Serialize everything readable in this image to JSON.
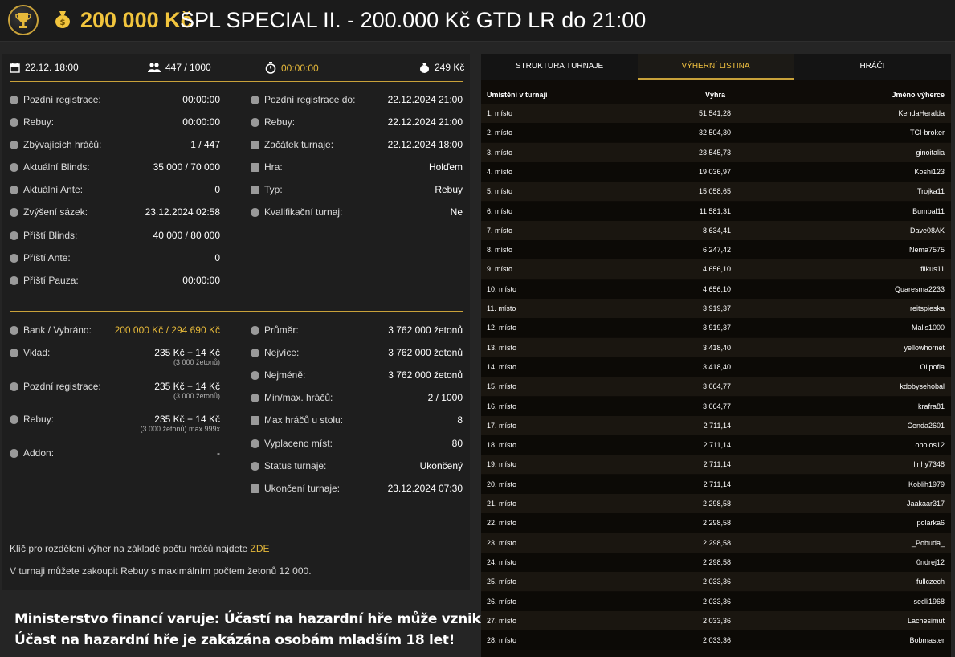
{
  "header": {
    "prize": "200 000 Kč",
    "title": "SPL SPECIAL II. - 200.000 Kč GTD LR do 21:00"
  },
  "topbar": {
    "date": "22.12. 18:00",
    "players": "447 / 1000",
    "timer": "00:00:00",
    "price": "249 Kč"
  },
  "info_left": [
    {
      "label": "Pozdní registrace:",
      "value": "00:00:00"
    },
    {
      "label": "Rebuy:",
      "value": "00:00:00"
    },
    {
      "label": "Zbývajících hráčů:",
      "value": "1 / 447"
    },
    {
      "label": "Aktuální Blinds:",
      "value": "35 000 / 70 000"
    },
    {
      "label": "Aktuální Ante:",
      "value": "0"
    },
    {
      "label": "Zvýšení sázek:",
      "value": "23.12.2024 02:58"
    },
    {
      "label": "Příští Blinds:",
      "value": "40 000 / 80 000"
    },
    {
      "label": "Příští Ante:",
      "value": "0"
    },
    {
      "label": "Příští Pauza:",
      "value": "00:00:00"
    }
  ],
  "info_right": [
    {
      "label": "Pozdní registrace do:",
      "value": "22.12.2024 21:00"
    },
    {
      "label": "Rebuy:",
      "value": "22.12.2024 21:00"
    },
    {
      "label": "Začátek turnaje:",
      "value": "22.12.2024 18:00"
    },
    {
      "label": "Hra:",
      "value": "Holďem"
    },
    {
      "label": "Typ:",
      "value": "Rebuy"
    },
    {
      "label": "Kvalifikační turnaj:",
      "value": "Ne"
    }
  ],
  "finance_left": [
    {
      "label": "Bank / Vybráno:",
      "value": "200 000 Kč / 294 690 Kč",
      "sub": ""
    },
    {
      "label": "Vklad:",
      "value": "235 Kč + 14 Kč",
      "sub": "(3 000 žetonů)"
    },
    {
      "label": "Pozdní registrace:",
      "value": "235 Kč + 14 Kč",
      "sub": "(3 000 žetonů)"
    },
    {
      "label": "Rebuy:",
      "value": "235 Kč + 14 Kč",
      "sub": "(3 000 žetonů) max 999x"
    },
    {
      "label": "Addon:",
      "value": "-",
      "sub": ""
    }
  ],
  "finance_right": [
    {
      "label": "Průměr:",
      "value": "3 762 000 žetonů"
    },
    {
      "label": "Nejvíce:",
      "value": "3 762 000 žetonů"
    },
    {
      "label": "Nejméně:",
      "value": "3 762 000 žetonů"
    },
    {
      "label": "Min/max. hráčů:",
      "value": "2 / 1000"
    },
    {
      "label": "Max hráčů u stolu:",
      "value": "8"
    },
    {
      "label": "Vyplaceno míst:",
      "value": "80"
    },
    {
      "label": "Status turnaje:",
      "value": "Ukončený"
    },
    {
      "label": "Ukončení turnaje:",
      "value": "23.12.2024 07:30"
    }
  ],
  "notes": {
    "key_text": "Klíč pro rozdělení výher na základě počtu hráčů najdete ",
    "key_link": "ZDE",
    "rebuy_text": "V turnaji můžete zakoupit Rebuy s maximálním počtem žetonů 12 000."
  },
  "warning": {
    "line1": "Ministerstvo financí varuje: Účastí na hazardní hře může vzniknout závislost!",
    "line2": "Účast na hazardní hře je zakázána osobám mladším 18 let!"
  },
  "tabs": [
    {
      "label": "STRUKTURA TURNAJE"
    },
    {
      "label": "VÝHERNÍ LISTINA"
    },
    {
      "label": "HRÁČI"
    }
  ],
  "payout_headers": {
    "place": "Umístění v turnaji",
    "prize": "Výhra",
    "winner": "Jméno výherce"
  },
  "payouts": [
    {
      "place": "1. místo",
      "prize": "51 541,28",
      "winner": "KendaHeralda"
    },
    {
      "place": "2. místo",
      "prize": "32 504,30",
      "winner": "TCI-broker"
    },
    {
      "place": "3. místo",
      "prize": "23 545,73",
      "winner": "ginoitalia"
    },
    {
      "place": "4. místo",
      "prize": "19 036,97",
      "winner": "Koshi123"
    },
    {
      "place": "5. místo",
      "prize": "15 058,65",
      "winner": "Trojka11"
    },
    {
      "place": "6. místo",
      "prize": "11 581,31",
      "winner": "Bumbal11"
    },
    {
      "place": "7. místo",
      "prize": "8 634,41",
      "winner": "Dave08AK"
    },
    {
      "place": "8. místo",
      "prize": "6 247,42",
      "winner": "Nema7575"
    },
    {
      "place": "9. místo",
      "prize": "4 656,10",
      "winner": "filkus11"
    },
    {
      "place": "10. místo",
      "prize": "4 656,10",
      "winner": "Quaresma2233"
    },
    {
      "place": "11. místo",
      "prize": "3 919,37",
      "winner": "reitspieska"
    },
    {
      "place": "12. místo",
      "prize": "3 919,37",
      "winner": "Malis1000"
    },
    {
      "place": "13. místo",
      "prize": "3 418,40",
      "winner": "yellowhornet"
    },
    {
      "place": "14. místo",
      "prize": "3 418,40",
      "winner": "Olipofia"
    },
    {
      "place": "15. místo",
      "prize": "3 064,77",
      "winner": "kdobysehobal"
    },
    {
      "place": "16. místo",
      "prize": "3 064,77",
      "winner": "krafra81"
    },
    {
      "place": "17. místo",
      "prize": "2 711,14",
      "winner": "Cenda2601"
    },
    {
      "place": "18. místo",
      "prize": "2 711,14",
      "winner": "obolos12"
    },
    {
      "place": "19. místo",
      "prize": "2 711,14",
      "winner": "linhy7348"
    },
    {
      "place": "20. místo",
      "prize": "2 711,14",
      "winner": "Koblih1979"
    },
    {
      "place": "21. místo",
      "prize": "2 298,58",
      "winner": "Jaakaar317"
    },
    {
      "place": "22. místo",
      "prize": "2 298,58",
      "winner": "polarka6"
    },
    {
      "place": "23. místo",
      "prize": "2 298,58",
      "winner": "_Pobuda_"
    },
    {
      "place": "24. místo",
      "prize": "2 298,58",
      "winner": "0ndrej12"
    },
    {
      "place": "25. místo",
      "prize": "2 033,36",
      "winner": "fullczech"
    },
    {
      "place": "26. místo",
      "prize": "2 033,36",
      "winner": "sedli1968"
    },
    {
      "place": "27. místo",
      "prize": "2 033,36",
      "winner": "Lachesimut"
    },
    {
      "place": "28. místo",
      "prize": "2 033,36",
      "winner": "Bobmaster"
    }
  ]
}
